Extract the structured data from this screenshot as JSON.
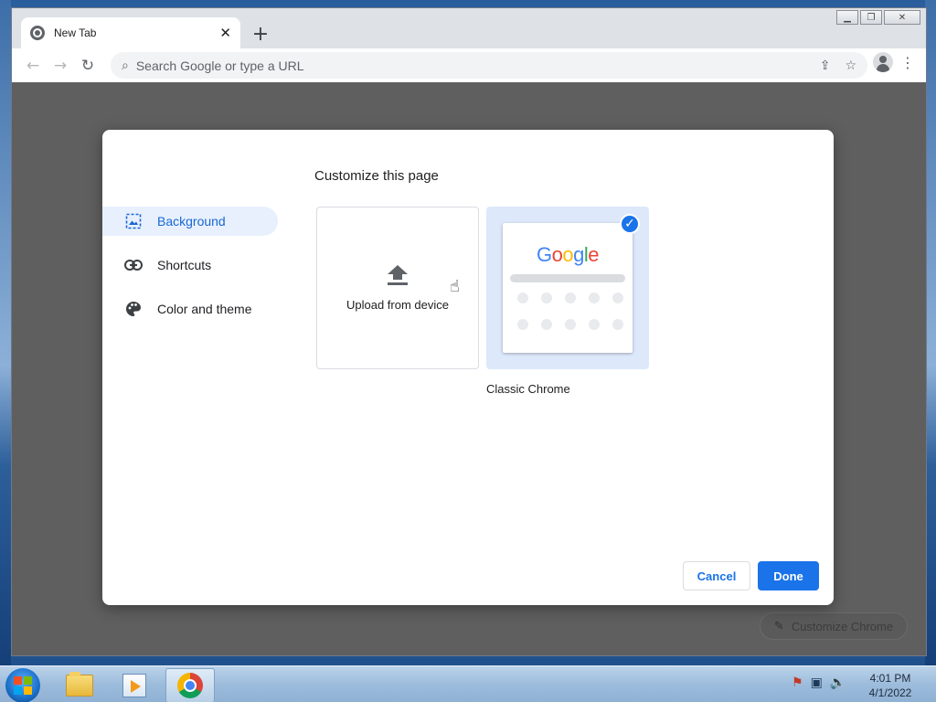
{
  "browser": {
    "tab_title": "New Tab",
    "omnibox_placeholder": "Search Google or type a URL"
  },
  "page": {
    "customize_chrome_label": "Customize Chrome"
  },
  "dialog": {
    "title": "Customize this page",
    "menu": [
      {
        "label": "Background",
        "icon": "image-icon",
        "active": true
      },
      {
        "label": "Shortcuts",
        "icon": "link-icon",
        "active": false
      },
      {
        "label": "Color and theme",
        "icon": "palette-icon",
        "active": false
      }
    ],
    "upload_label": "Upload from device",
    "classic_label": "Classic Chrome",
    "classic_logo": "Google",
    "cancel_label": "Cancel",
    "done_label": "Done",
    "colors": {
      "accent": "#1a73e8",
      "selected_bg": "#e8f0fe"
    }
  },
  "taskbar": {
    "time": "4:01 PM",
    "date": "4/1/2022"
  }
}
